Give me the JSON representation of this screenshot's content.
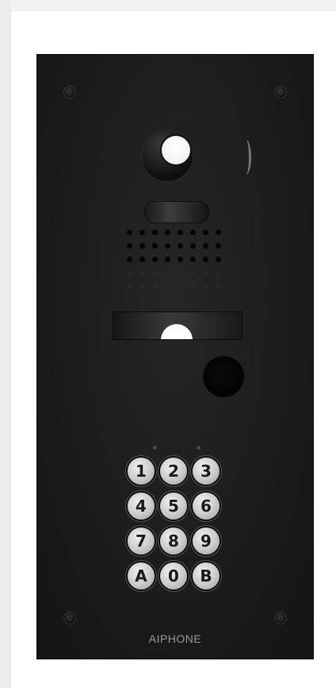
{
  "panel": {
    "brand": "AIPHONE",
    "keypad": {
      "keys": [
        "1",
        "2",
        "3",
        "4",
        "5",
        "6",
        "7",
        "8",
        "9",
        "A",
        "0",
        "B"
      ]
    }
  },
  "colors": {
    "panel": "#1c1c1c",
    "key": "#c9c9c9",
    "lens": "#ffffff"
  },
  "icons": {
    "camera": "camera-lens-icon",
    "screw": "screw-icon",
    "proximity": "proximity-reader-icon"
  }
}
